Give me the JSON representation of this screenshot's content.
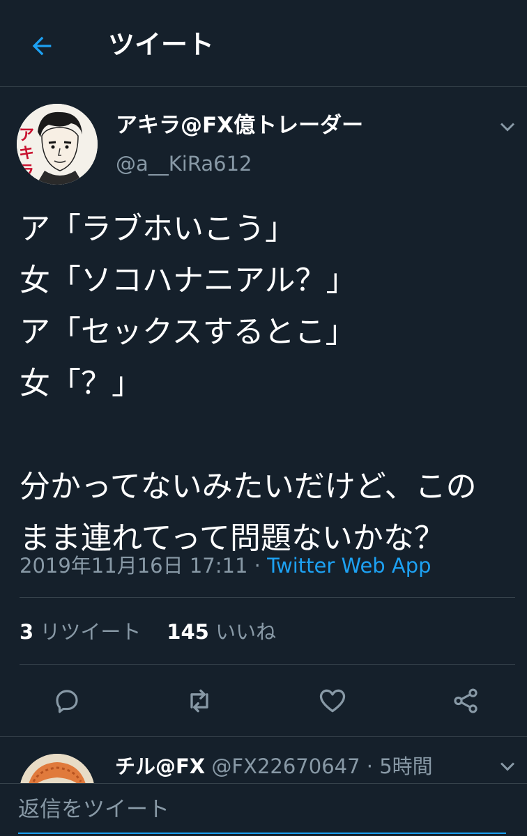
{
  "colors": {
    "background": "#15202b",
    "accent": "#1da1f2",
    "secondary_text": "#8899a6",
    "divider": "#38444d"
  },
  "header": {
    "back_icon": "arrow-left-icon",
    "title": "ツイート"
  },
  "tweet": {
    "author": {
      "display_name": "アキラ@FX億トレーダー",
      "handle": "@a__KiRa612",
      "avatar_text": "アキラ"
    },
    "text": "ア「ラブホいこう」\n女「ソコハナニアル？」\nア「セックスするとこ」\n女「？」\n\n分かってないみたいだけど、この\nまま連れてって問題ないかな？",
    "timestamp": "2019年11月16日 17:11",
    "separator": " · ",
    "source": "Twitter Web App",
    "retweet_count": "3",
    "retweet_label": "リツイート",
    "like_count": "145",
    "like_label": "いいね",
    "actions": [
      {
        "icon": "reply-icon"
      },
      {
        "icon": "retweet-icon"
      },
      {
        "icon": "heart-icon"
      },
      {
        "icon": "share-icon"
      }
    ]
  },
  "reply_preview": {
    "display_name": "チル@FX",
    "handle": "@FX22670647",
    "separator": " · ",
    "time": "5時間"
  },
  "composer": {
    "placeholder": "返信をツイート"
  }
}
